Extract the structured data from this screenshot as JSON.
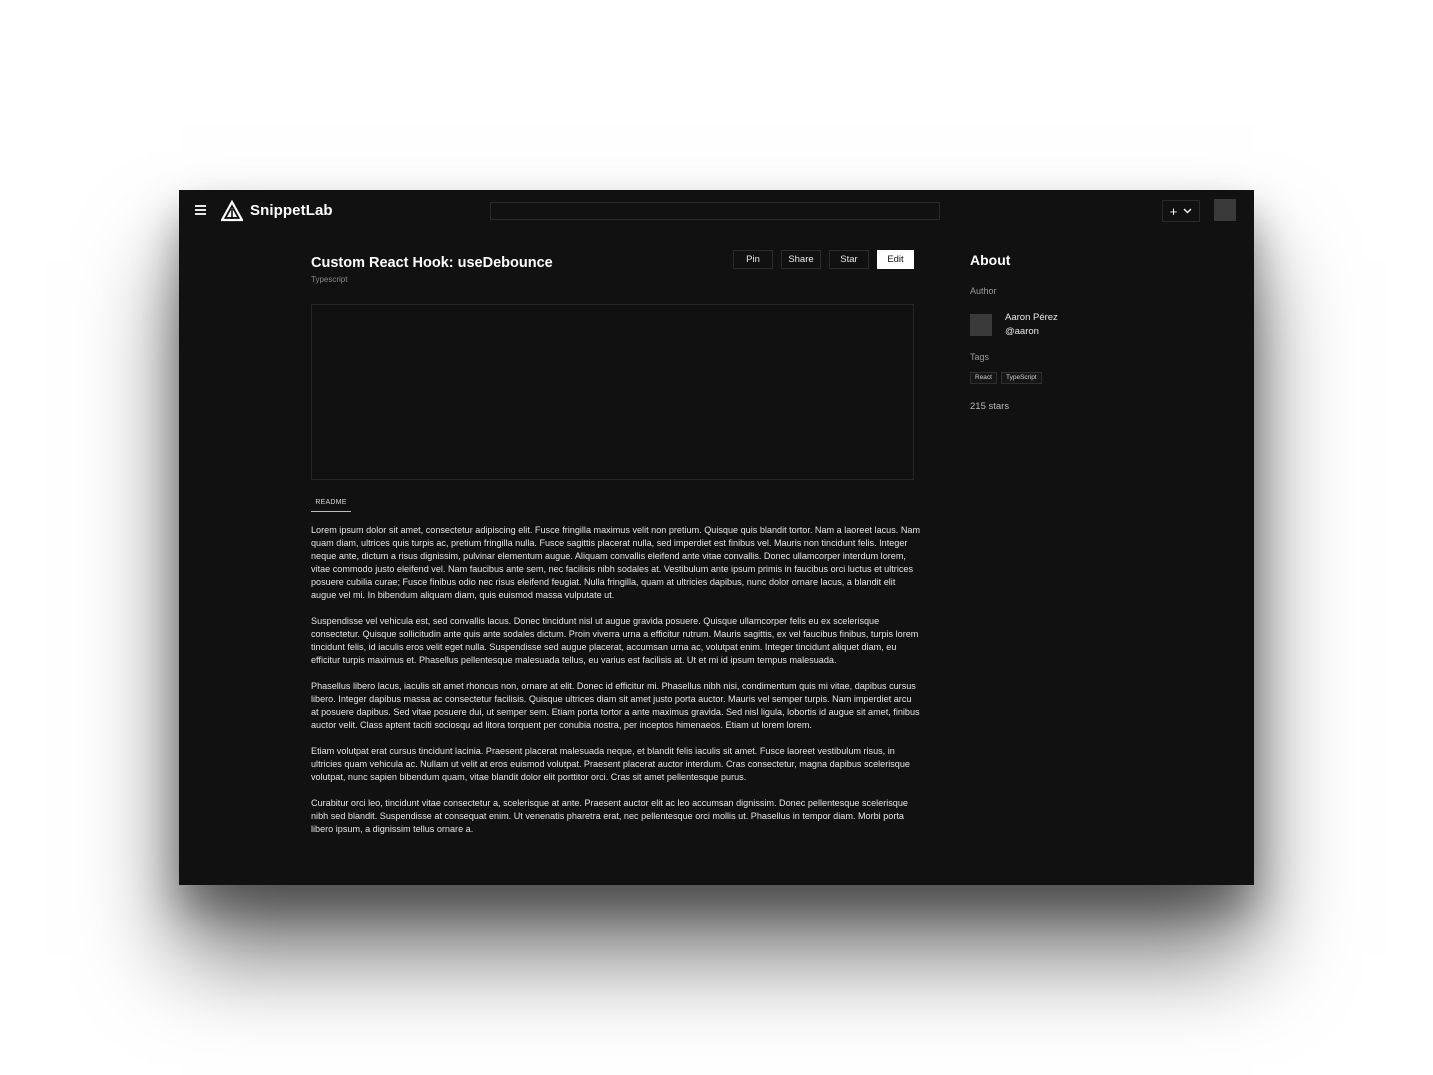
{
  "app": {
    "brand": "SnippetLab",
    "search_placeholder": "",
    "create_label": "+"
  },
  "snippet": {
    "title": "Custom React Hook: useDebounce",
    "language": "Typescript",
    "actions": {
      "pin": "Pin",
      "share": "Share",
      "star": "Star",
      "edit": "Edit"
    },
    "readme_tab": "README",
    "readme_paragraphs": [
      "Lorem ipsum dolor sit amet, consectetur adipiscing elit. Fusce fringilla maximus velit non pretium. Quisque quis blandit tortor. Nam a laoreet lacus. Nam quam diam, ultrices quis turpis ac, pretium fringilla nulla. Fusce sagittis placerat nulla, sed imperdiet est finibus vel. Mauris non tincidunt felis. Integer neque ante, dictum a risus dignissim, pulvinar elementum augue. Aliquam convallis eleifend ante vitae convallis. Donec ullamcorper interdum lorem, vitae commodo justo eleifend vel. Nam faucibus ante sem, nec facilisis nibh sodales at. Vestibulum ante ipsum primis in faucibus orci luctus et ultrices posuere cubilia curae; Fusce finibus odio nec risus eleifend feugiat. Nulla fringilla, quam at ultricies dapibus, nunc dolor ornare lacus, a blandit elit augue vel mi. In bibendum aliquam diam, quis euismod massa vulputate ut.",
      "Suspendisse vel vehicula est, sed convallis lacus. Donec tincidunt nisl ut augue gravida posuere. Quisque ullamcorper felis eu ex scelerisque consectetur. Quisque sollicitudin ante quis ante sodales dictum. Proin viverra urna a efficitur rutrum. Mauris sagittis, ex vel faucibus finibus, turpis lorem tincidunt felis, id iaculis eros velit eget nulla. Suspendisse sed augue placerat, accumsan urna ac, volutpat enim. Integer tincidunt aliquet diam, eu efficitur turpis maximus et. Phasellus pellentesque malesuada tellus, eu varius est facilisis at. Ut et mi id ipsum tempus malesuada.",
      "Phasellus libero lacus, iaculis sit amet rhoncus non, ornare at elit. Donec id efficitur mi. Phasellus nibh nisi, condimentum quis mi vitae, dapibus cursus libero. Integer dapibus massa ac consectetur facilisis. Quisque ultrices diam sit amet justo porta auctor. Mauris vel semper turpis. Nam imperdiet arcu at posuere dapibus. Sed vitae posuere dui, ut semper sem. Etiam porta tortor a ante maximus gravida. Sed nisl ligula, lobortis id augue sit amet, finibus auctor velit. Class aptent taciti sociosqu ad litora torquent per conubia nostra, per inceptos himenaeos. Etiam ut lorem lorem.",
      "Etiam volutpat erat cursus tincidunt lacinia. Praesent placerat malesuada neque, et blandit felis iaculis sit amet. Fusce laoreet vestibulum risus, in ultricies quam vehicula ac. Nullam ut velit at eros euismod volutpat. Praesent placerat auctor interdum. Cras consectetur, magna dapibus scelerisque volutpat, nunc sapien bibendum quam, vitae blandit dolor elit porttitor orci. Cras sit amet pellentesque purus.",
      "Curabitur orci leo, tincidunt vitae consectetur a, scelerisque at ante. Praesent auctor elit ac leo accumsan dignissim. Donec pellentesque scelerisque nibh sed blandit. Suspendisse at consequat enim. Ut venenatis pharetra erat, nec pellentesque orci mollis ut. Phasellus in tempor diam. Morbi porta libero ipsum, a dignissim tellus ornare a."
    ]
  },
  "sidebar": {
    "title": "About",
    "author_label": "Author",
    "author_name": "Aaron Pérez",
    "author_handle": "@aaron",
    "tags_label": "Tags",
    "tags": [
      "React",
      "TypeScript"
    ],
    "stars": "215 stars"
  },
  "colors": {
    "background": "#111111",
    "text": "#e8e8e8",
    "primary_button_bg": "#ffffff",
    "border": "#2a2a2a"
  }
}
